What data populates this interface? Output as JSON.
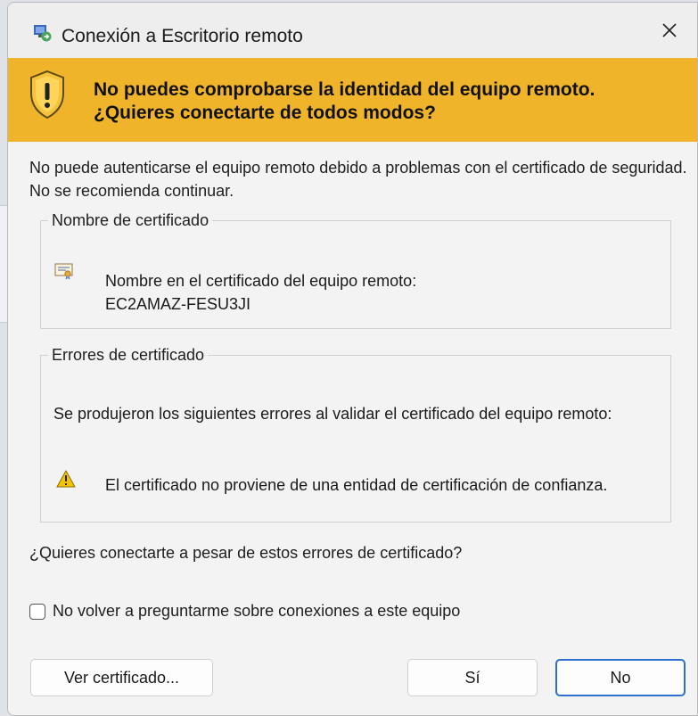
{
  "window": {
    "title": "Conexión a Escritorio remoto"
  },
  "warning": {
    "line1": "No puedes comprobarse la identidad del equipo remoto.",
    "line2": "¿Quieres conectarte de todos modos?"
  },
  "intro": "No puede autenticarse el equipo remoto debido a problemas con el certificado de seguridad. No se recomienda continuar.",
  "cert_name_group": {
    "title": "Nombre de certificado",
    "label": "Nombre en el certificado del equipo remoto:",
    "value": "EC2AMAZ-FESU3JI"
  },
  "cert_errors_group": {
    "title": "Errores de certificado",
    "description": "Se produjeron los siguientes errores al validar el certificado del equipo remoto:",
    "errors": [
      "El certificado no proviene de una entidad de certificación de confianza."
    ]
  },
  "question": "¿Quieres conectarte a pesar de estos errores de certificado?",
  "checkbox": {
    "label": "No volver a preguntarme sobre conexiones a este equipo",
    "checked": false
  },
  "buttons": {
    "view_cert": "Ver certificado...",
    "yes": "Sí",
    "no": "No"
  },
  "icons": {
    "app": "remote-desktop-icon",
    "close": "close-icon",
    "shield": "warning-shield-icon",
    "cert": "certificate-icon",
    "warn": "warning-triangle-icon"
  },
  "colors": {
    "warning_band": "#f0b42a",
    "default_button_border": "#2f6fcf"
  }
}
